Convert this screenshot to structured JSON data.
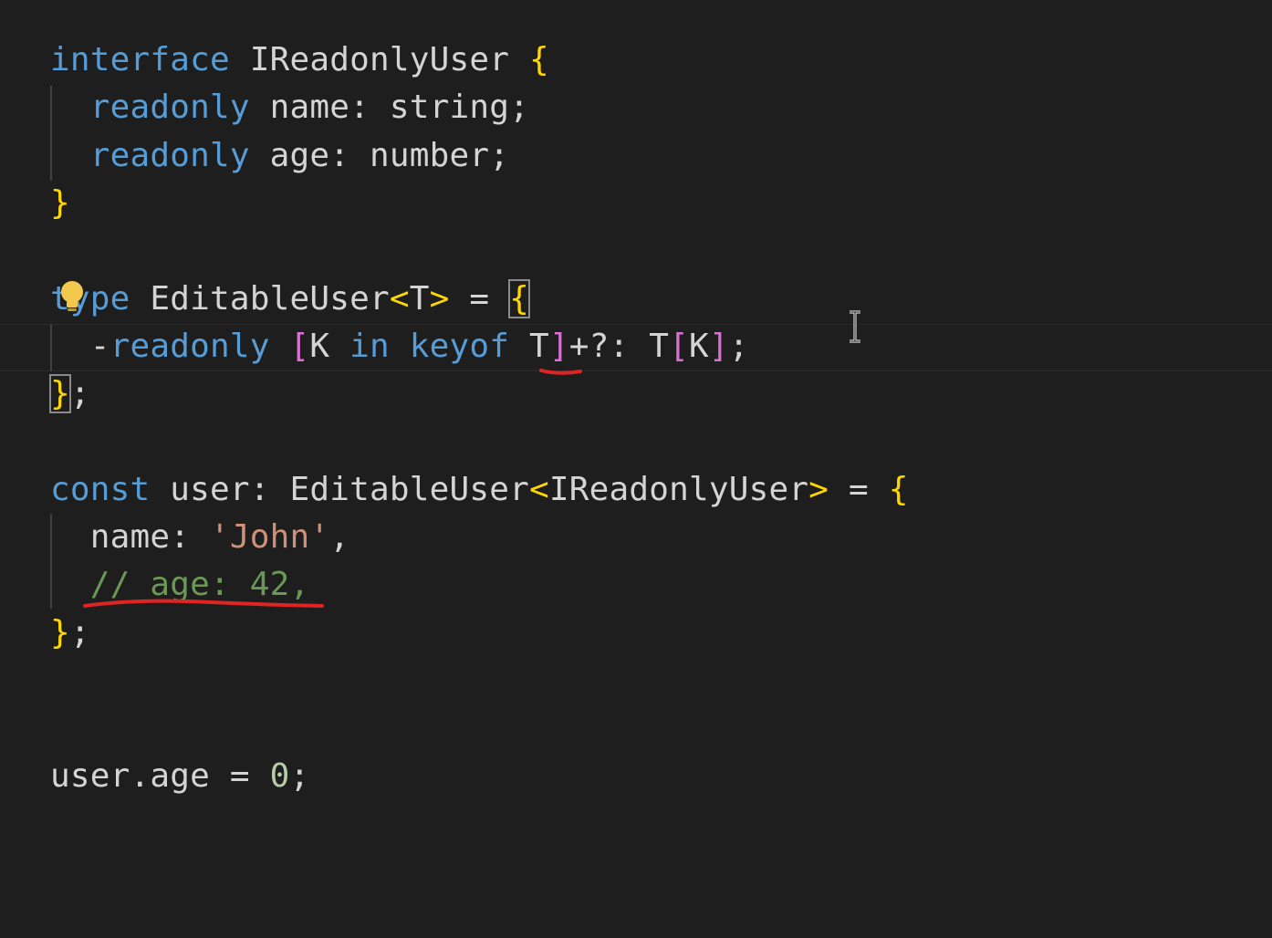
{
  "editor": {
    "lines": [
      {
        "tokens": [
          {
            "t": "interface",
            "c": "kw"
          },
          {
            "t": " IReadonlyUser ",
            "c": "ty"
          },
          {
            "t": "{",
            "c": "br1"
          }
        ]
      },
      {
        "tokens": [
          {
            "t": "  ",
            "c": "pl"
          },
          {
            "t": "readonly",
            "c": "kw"
          },
          {
            "t": " name: string;",
            "c": "pl"
          }
        ]
      },
      {
        "tokens": [
          {
            "t": "  ",
            "c": "pl"
          },
          {
            "t": "readonly",
            "c": "kw"
          },
          {
            "t": " age: number;",
            "c": "pl"
          }
        ]
      },
      {
        "tokens": [
          {
            "t": "}",
            "c": "br1"
          }
        ]
      },
      {
        "tokens": []
      },
      {
        "tokens": [
          {
            "t": "type",
            "c": "kw"
          },
          {
            "t": " EditableUser",
            "c": "ty"
          },
          {
            "t": "<",
            "c": "br1"
          },
          {
            "t": "T",
            "c": "ty"
          },
          {
            "t": ">",
            "c": "br1"
          },
          {
            "t": " = ",
            "c": "pl"
          },
          {
            "t": "{",
            "c": "br1",
            "box": true
          }
        ]
      },
      {
        "tokens": [
          {
            "t": "  -",
            "c": "pl"
          },
          {
            "t": "readonly",
            "c": "kw"
          },
          {
            "t": " ",
            "c": "pl"
          },
          {
            "t": "[",
            "c": "br2"
          },
          {
            "t": "K ",
            "c": "ty"
          },
          {
            "t": "in",
            "c": "kw"
          },
          {
            "t": " ",
            "c": "pl"
          },
          {
            "t": "keyof",
            "c": "kw"
          },
          {
            "t": " T",
            "c": "ty"
          },
          {
            "t": "]",
            "c": "br2"
          },
          {
            "t": "+?: T",
            "c": "pl"
          },
          {
            "t": "[",
            "c": "br2"
          },
          {
            "t": "K",
            "c": "ty"
          },
          {
            "t": "]",
            "c": "br2"
          },
          {
            "t": ";",
            "c": "pl"
          }
        ]
      },
      {
        "tokens": [
          {
            "t": "}",
            "c": "br1",
            "box": true
          },
          {
            "t": ";",
            "c": "pl"
          }
        ]
      },
      {
        "tokens": []
      },
      {
        "tokens": [
          {
            "t": "const",
            "c": "kw"
          },
          {
            "t": " user: EditableUser",
            "c": "ty"
          },
          {
            "t": "<",
            "c": "br1"
          },
          {
            "t": "IReadonlyUser",
            "c": "ty"
          },
          {
            "t": ">",
            "c": "br1"
          },
          {
            "t": " = ",
            "c": "pl"
          },
          {
            "t": "{",
            "c": "br1"
          }
        ]
      },
      {
        "tokens": [
          {
            "t": "  name: ",
            "c": "pl"
          },
          {
            "t": "'John'",
            "c": "str"
          },
          {
            "t": ",",
            "c": "pl"
          }
        ]
      },
      {
        "tokens": [
          {
            "t": "  ",
            "c": "pl"
          },
          {
            "t": "// age: 42,",
            "c": "cm"
          }
        ]
      },
      {
        "tokens": [
          {
            "t": "}",
            "c": "br1"
          },
          {
            "t": ";",
            "c": "pl"
          }
        ]
      },
      {
        "tokens": []
      },
      {
        "tokens": []
      },
      {
        "tokens": [
          {
            "t": "user.age = ",
            "c": "pl"
          },
          {
            "t": "0",
            "c": "num"
          },
          {
            "t": ";",
            "c": "pl"
          }
        ]
      }
    ]
  },
  "icons": {
    "lightbulb": "lightbulb-icon",
    "cursor": "text-cursor-icon"
  },
  "colors": {
    "background": "#1e1e1e",
    "keyword": "#569cd6",
    "bracket": "#ffd700",
    "bracket_inner": "#da70d6",
    "string": "#ce9178",
    "comment": "#6a9955",
    "annotation": "#e02424"
  }
}
